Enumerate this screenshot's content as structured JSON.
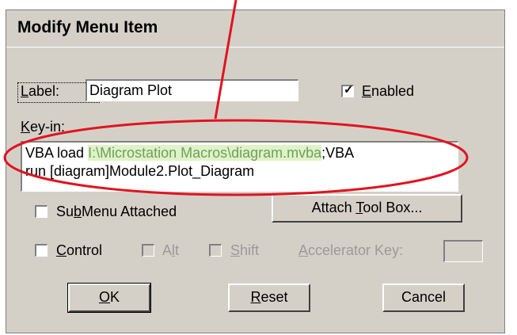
{
  "window": {
    "title": "Modify Menu Item"
  },
  "label": {
    "caption": "Label:",
    "value": "Diagram Plot"
  },
  "enabled": {
    "label": "Enabled",
    "checked": true
  },
  "keyin": {
    "caption": "Key-in:",
    "prefix": "VBA load ",
    "path": "I:\\Microstation Macros\\diagram.mvba",
    "suffix": ";VBA",
    "line2": "run [diagram]Module2.Plot_Diagram"
  },
  "submenu": {
    "label": "SubMenu Attached",
    "checked": false
  },
  "attach_toolbox_button": "Attach Tool Box...",
  "modifiers": {
    "control": "Control",
    "alt": "Alt",
    "shift": "Shift",
    "accelerator_label": "Accelerator Key:",
    "accelerator_value": ""
  },
  "buttons": {
    "ok": "OK",
    "reset": "Reset",
    "cancel": "Cancel"
  },
  "colors": {
    "annotation": "#e0141e",
    "highlight_bg": "#dff2c8"
  }
}
